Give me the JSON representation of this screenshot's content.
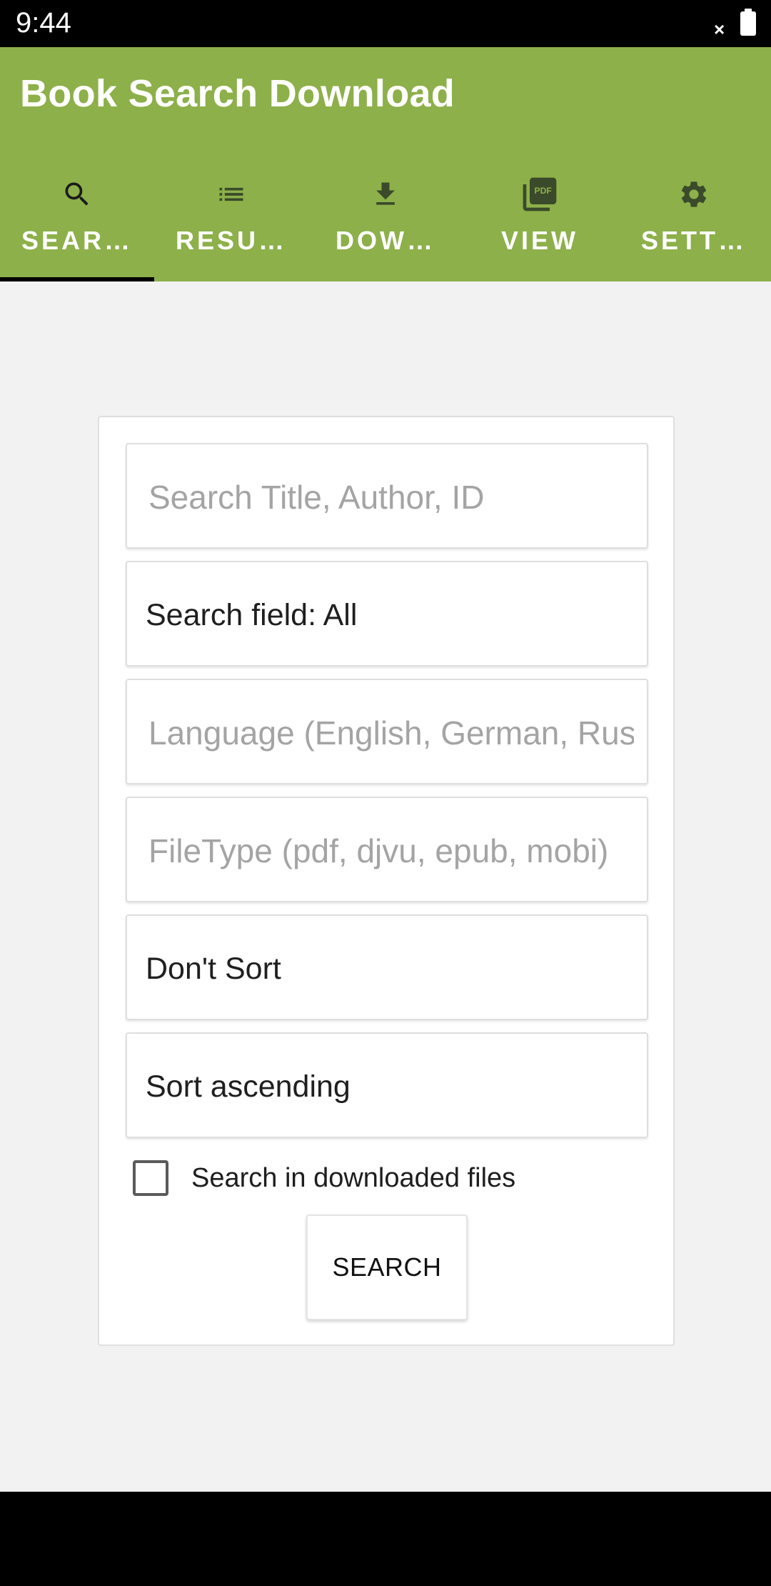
{
  "status_bar": {
    "time": "9:44",
    "signal_glyph": "×",
    "icons": [
      "signal-off-icon",
      "battery-icon"
    ]
  },
  "app_bar": {
    "title": "Book Search Download",
    "background": "#8db04a"
  },
  "tabs": [
    {
      "label": "SEAR…",
      "icon": "search-icon",
      "selected": true
    },
    {
      "label": "RESU…",
      "icon": "list-icon",
      "selected": false
    },
    {
      "label": "DOW…",
      "icon": "download-icon",
      "selected": false
    },
    {
      "label": "VIEW",
      "icon": "pdf-icon",
      "selected": false
    },
    {
      "label": "SETT…",
      "icon": "gear-icon",
      "selected": false
    }
  ],
  "form": {
    "search_placeholder": "Search Title, Author, ID",
    "search_field_value": "Search field: All",
    "language_placeholder": "Language (English, German, Russian)",
    "filetype_placeholder": "FileType (pdf, djvu, epub, mobi)",
    "sort_value": "Don't Sort",
    "sort_order_value": "Sort ascending",
    "checkbox_label": "Search in downloaded files",
    "checkbox_checked": false,
    "search_button_label": "SEARCH"
  }
}
